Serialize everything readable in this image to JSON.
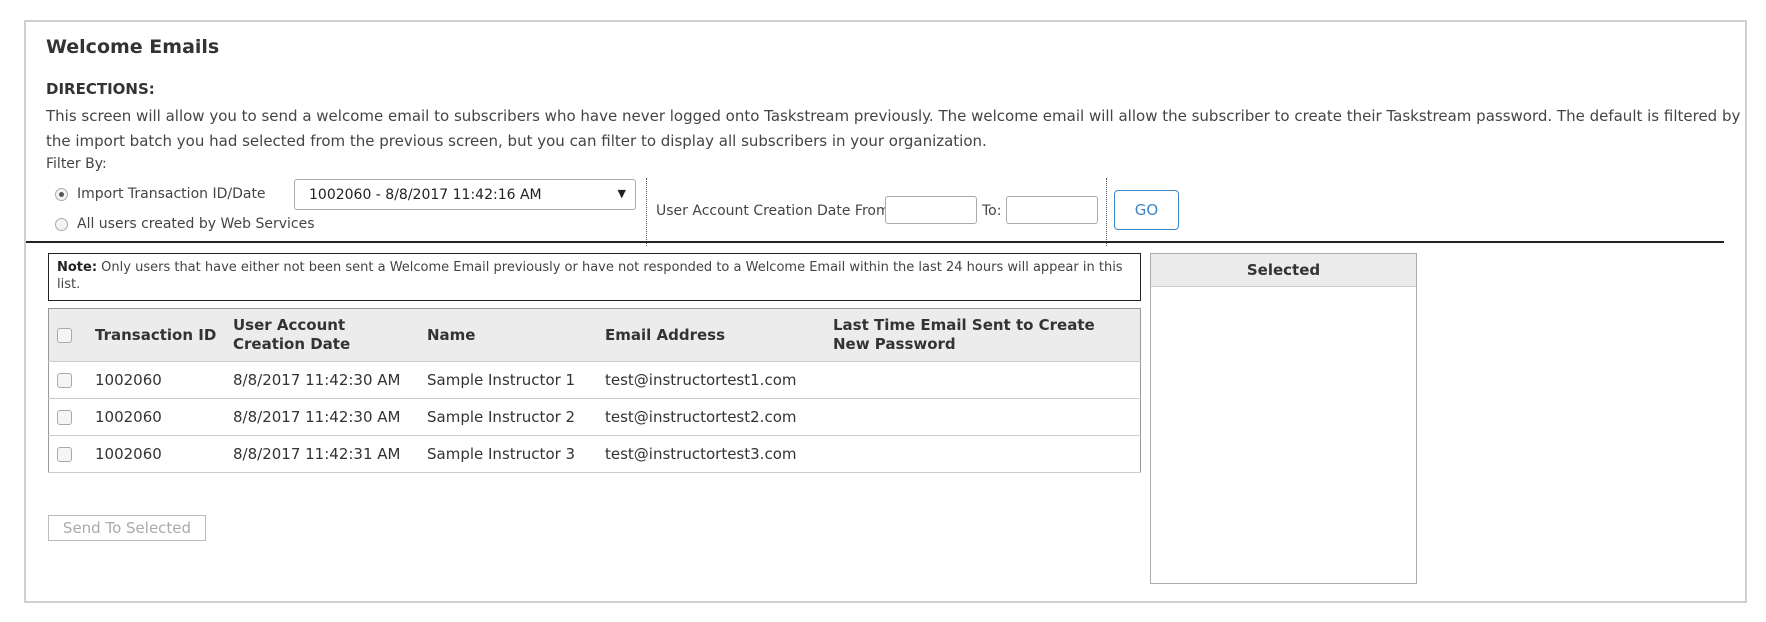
{
  "page": {
    "title": "Welcome Emails",
    "directions_label": "DIRECTIONS:",
    "directions_text": "This screen will allow you to send a welcome email to subscribers who have never logged onto Taskstream previously. The welcome email will allow the subscriber to create their Taskstream password. The default is filtered by the import batch you had selected from the previous screen, but you can filter to display all subscribers in your organization."
  },
  "filter": {
    "label": "Filter By:",
    "option_import": "Import Transaction ID/Date",
    "option_all": "All users created by Web Services",
    "selected_option": "import",
    "select_value": "1002060 - 8/8/2017 11:42:16 AM",
    "date_from_label": "User Account Creation Date From:",
    "date_to_label": "To:",
    "date_from_value": "",
    "date_to_value": "",
    "go_label": "GO"
  },
  "note": {
    "bold": "Note:",
    "text": " Only users that have either not been sent a Welcome Email previously or have not responded to a Welcome Email within the last 24 hours will appear in this list."
  },
  "table": {
    "headers": {
      "transaction_id": "Transaction ID",
      "creation_date": "User Account Creation Date",
      "name": "Name",
      "email": "Email Address",
      "last_sent": "Last Time Email Sent to Create New Password"
    },
    "rows": [
      {
        "transaction_id": "1002060",
        "creation_date": "8/8/2017 11:42:30 AM",
        "name": "Sample Instructor 1",
        "email": "test@instructortest1.com",
        "last_sent": ""
      },
      {
        "transaction_id": "1002060",
        "creation_date": "8/8/2017 11:42:30 AM",
        "name": "Sample Instructor 2",
        "email": "test@instructortest2.com",
        "last_sent": ""
      },
      {
        "transaction_id": "1002060",
        "creation_date": "8/8/2017 11:42:31 AM",
        "name": "Sample Instructor 3",
        "email": "test@instructortest3.com",
        "last_sent": ""
      }
    ]
  },
  "actions": {
    "send_label": "Send To Selected"
  },
  "selected_panel": {
    "header": "Selected"
  },
  "colors": {
    "accent": "#3a86c8",
    "header_bg": "#ececec",
    "border": "#cfcfcf"
  }
}
